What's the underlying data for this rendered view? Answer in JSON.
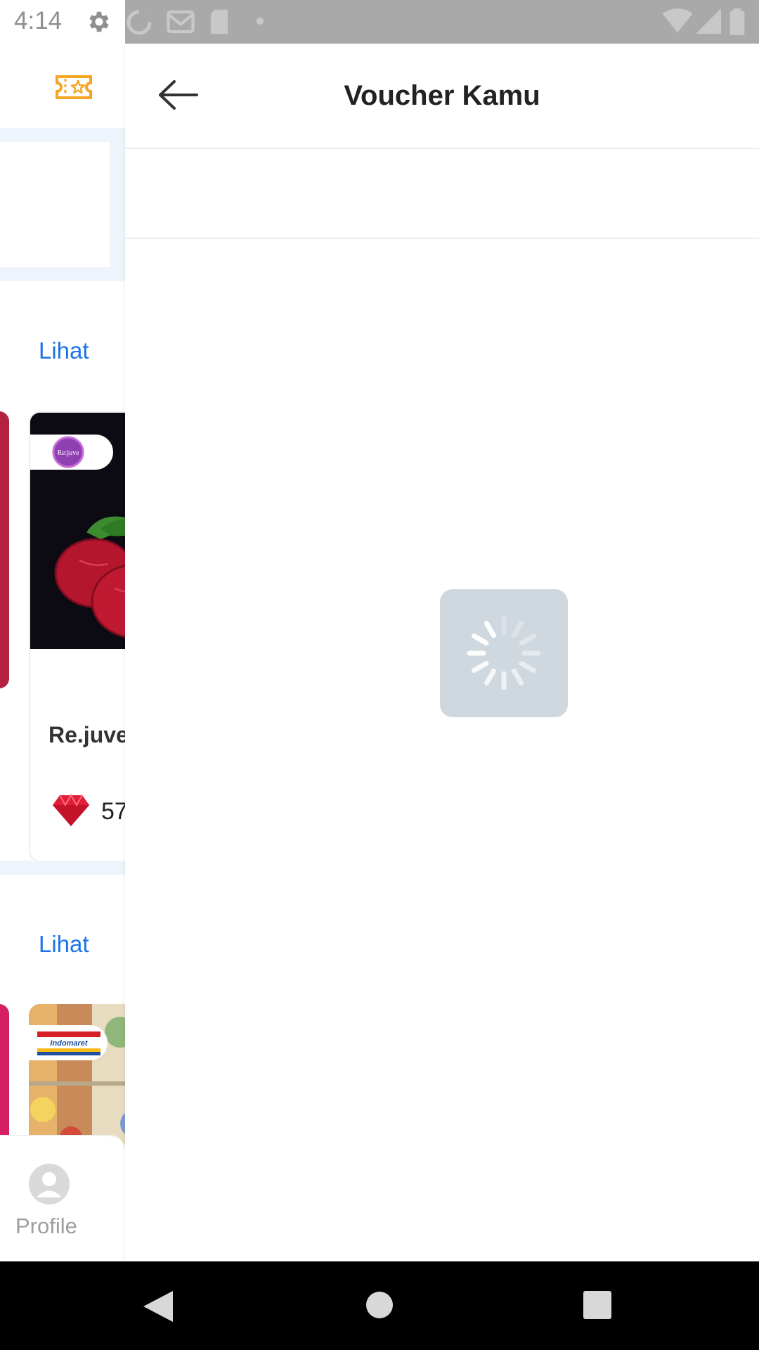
{
  "status_bar": {
    "time": "4:14",
    "icons": [
      "gear-icon",
      "sync-icon",
      "gmail-icon",
      "sd-card-icon",
      "dot-icon",
      "wifi-icon",
      "signal-icon",
      "battery-icon"
    ]
  },
  "background_page": {
    "voucher_icon": "ticket-star-icon",
    "section1_link": "Lihat",
    "card1": {
      "brand": "Re:juve",
      "title": "Re.juve",
      "points_icon": "ruby-icon",
      "points": "57"
    },
    "section2_link": "Lihat",
    "card2": {
      "brand": "Indomaret"
    },
    "bottom_nav": {
      "profile_label": "Profile",
      "profile_icon": "profile-icon"
    }
  },
  "voucher_screen": {
    "title": "Voucher Kamu",
    "back_icon": "arrow-left-icon",
    "loading": true
  },
  "system_nav": {
    "buttons": [
      "back-triangle-icon",
      "home-circle-icon",
      "recents-square-icon"
    ]
  },
  "colors": {
    "link": "#1a73e8",
    "voucher_icon": "#f5a623",
    "loader_bg": "#cfd8df",
    "status_bar_overlay": "#a9a9a9"
  }
}
